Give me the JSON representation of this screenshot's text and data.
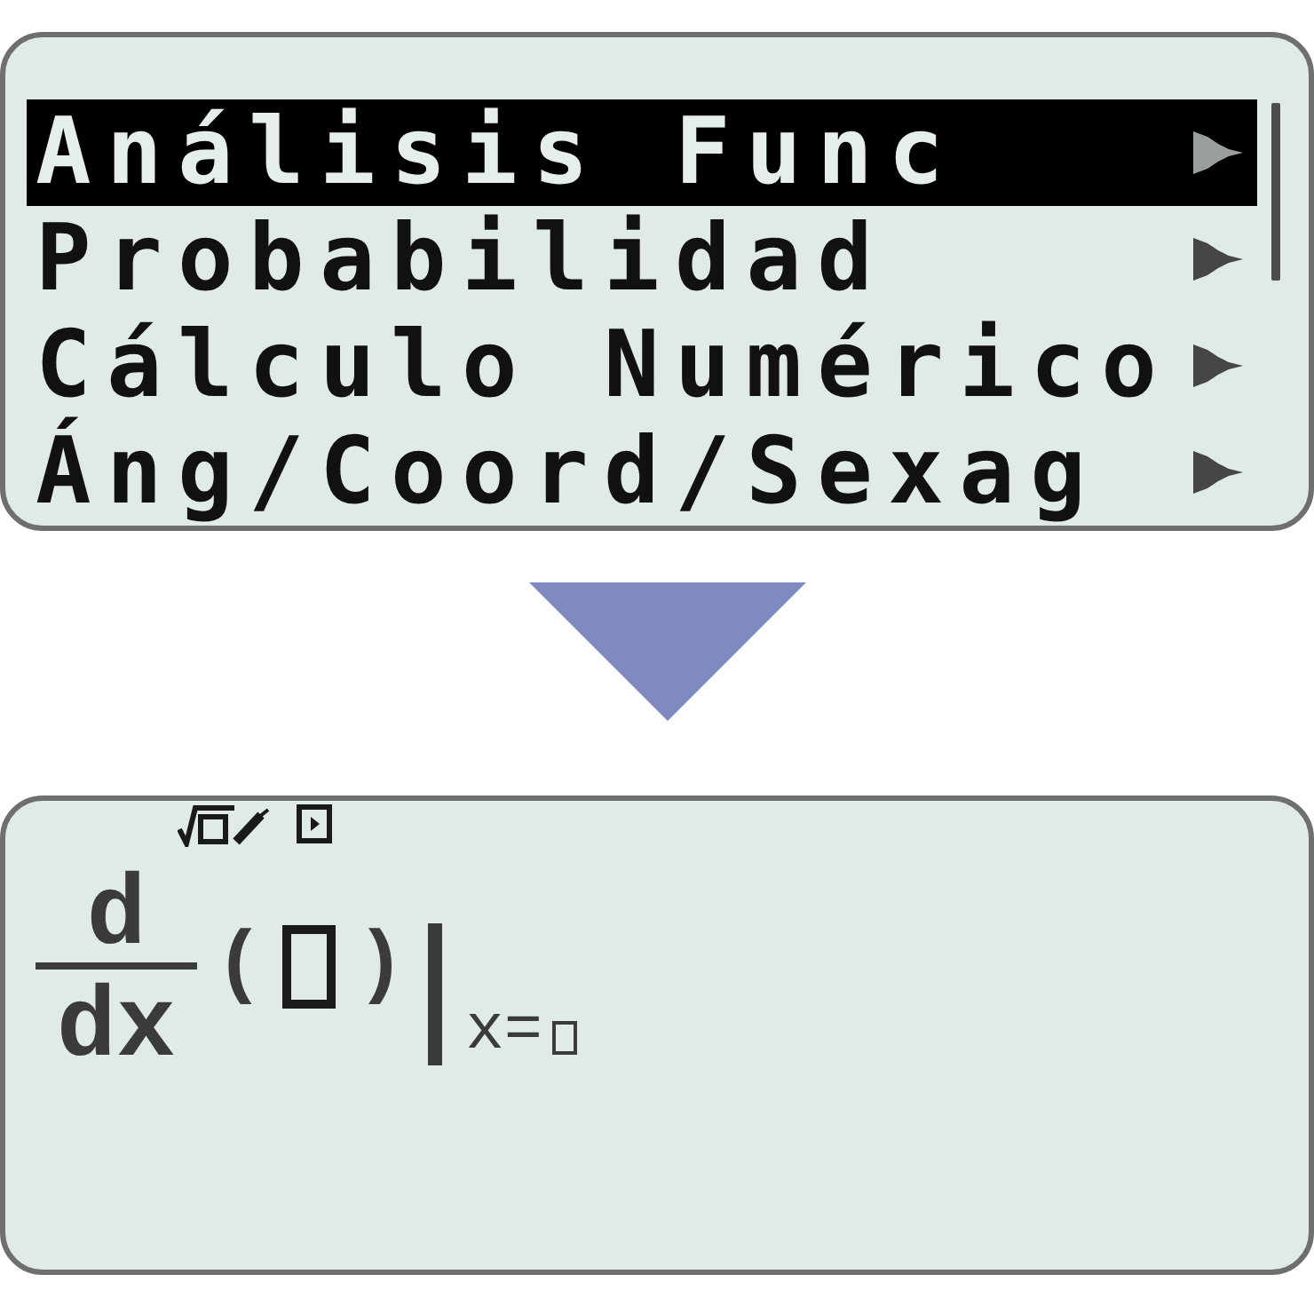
{
  "menu": {
    "items": [
      {
        "label": "Análisis Func",
        "selected": true
      },
      {
        "label": "Probabilidad",
        "selected": false
      },
      {
        "label": "Cálculo Numérico",
        "selected": false
      },
      {
        "label": "Áng/Coord/Sexag",
        "selected": false
      }
    ]
  },
  "display": {
    "expression": {
      "numerator": "d",
      "denominator": "dx",
      "open_paren": "(",
      "close_paren": ")",
      "subscript": "x="
    }
  }
}
